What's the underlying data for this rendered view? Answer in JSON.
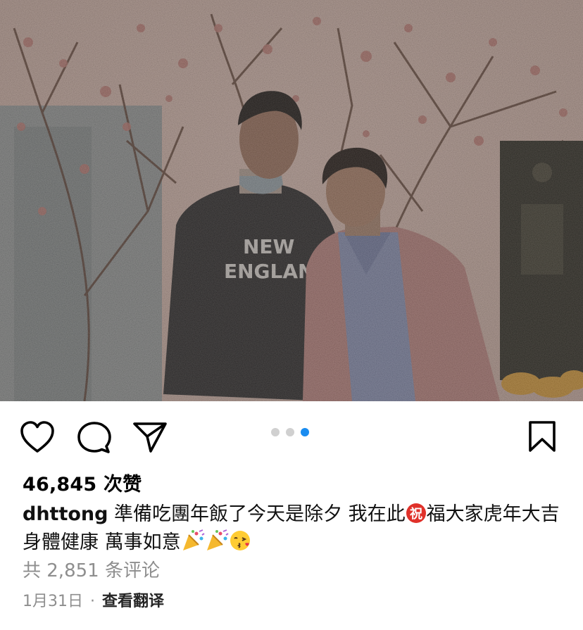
{
  "post": {
    "image": {
      "description_icons": [
        "photo"
      ],
      "shirt_text_line1": "NEW",
      "shirt_text_line2": "ENGLAND"
    },
    "carousel": {
      "total": 3,
      "active_index": 2
    },
    "likes_label": "46,845 次赞",
    "caption": {
      "username": "dhttong",
      "text_part1": " 準備吃團年飯了今天是除夕 我在此",
      "blessing_emoji": "祝",
      "text_part2": "福大家虎年大吉 身體健康 萬事如意",
      "trailing_emojis": [
        "party-popper",
        "party-popper",
        "kissing-face"
      ]
    },
    "comments_label": "共 2,851 条评论",
    "date": "1月31日",
    "separator": "·",
    "translate_label": "查看翻译"
  },
  "colors": {
    "accent": "#1a8cf0",
    "muted_text": "#8e8e8e",
    "blessing_red": "#e0312a"
  },
  "icons": {
    "like": "heart-icon",
    "comment": "comment-bubble-icon",
    "share": "paper-plane-icon",
    "save": "bookmark-icon"
  }
}
